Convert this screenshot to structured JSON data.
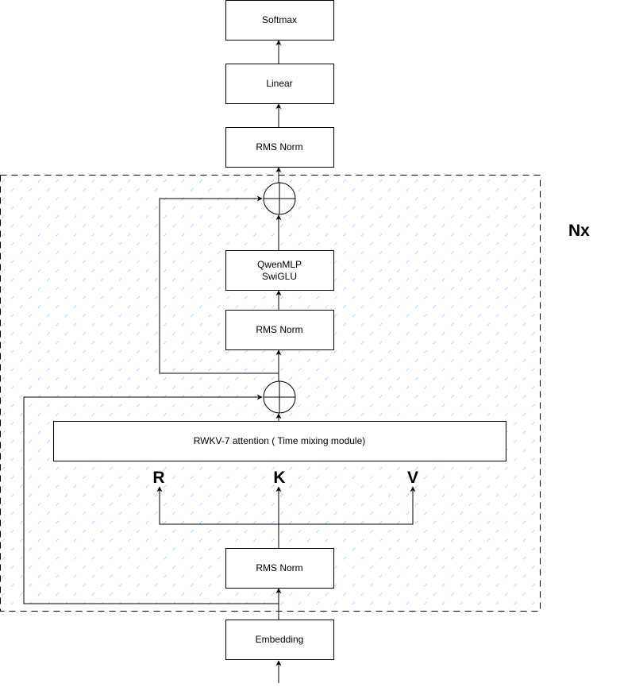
{
  "diagram": {
    "repeat_label": "Nx",
    "colors": {
      "stroke": "#000000",
      "box_fill": "#ffffff",
      "hatch": "#99ccff"
    },
    "blocks": {
      "softmax": "Softmax",
      "linear": "Linear",
      "rms_norm_final": "RMS Norm",
      "qwen_mlp_line1": "QwenMLP",
      "qwen_mlp_line2": "SwiGLU",
      "rms_norm_mlp": "RMS Norm",
      "rwkv_attention": "RWKV-7 attention ( Time mixing module)",
      "rms_norm_attn": "RMS Norm",
      "embedding": "Embedding"
    },
    "inputs": {
      "r": "R",
      "k": "K",
      "v": "V"
    },
    "operators": [
      "add",
      "add"
    ]
  }
}
